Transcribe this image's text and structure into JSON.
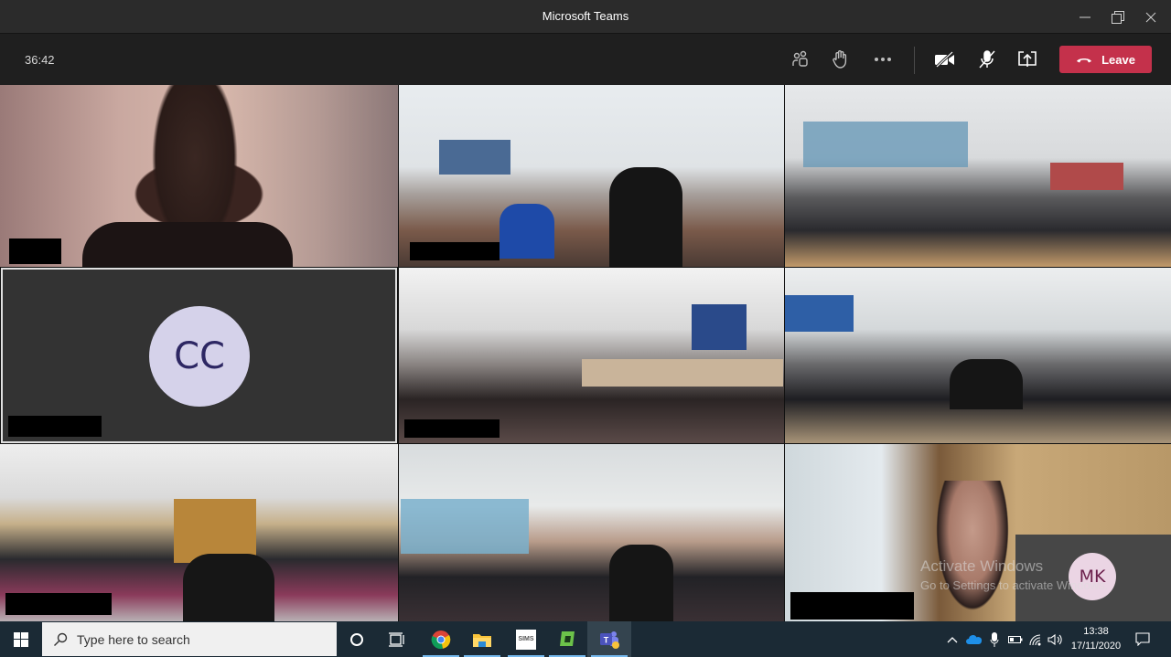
{
  "window": {
    "title": "Microsoft Teams",
    "controls": [
      "minimize-icon",
      "restore-icon",
      "close-icon"
    ]
  },
  "toolbar": {
    "timer": "36:42",
    "buttons": [
      {
        "name": "participants-button",
        "icon": "people-icon"
      },
      {
        "name": "raise-hand-button",
        "icon": "hand-icon"
      },
      {
        "name": "more-actions-button",
        "icon": "ellipsis-icon"
      },
      {
        "name": "camera-toggle-button",
        "icon": "camera-off-icon"
      },
      {
        "name": "mic-toggle-button",
        "icon": "mic-off-icon"
      },
      {
        "name": "share-screen-button",
        "icon": "share-tray-icon"
      }
    ],
    "leave_label": "Leave",
    "leave_color": "#c4314b"
  },
  "video_grid": {
    "tiles": [
      {
        "type": "video",
        "description": "Woman at home with blurred background",
        "name_redacted": true
      },
      {
        "type": "video",
        "description": "Classroom with student standing",
        "name_redacted": true
      },
      {
        "type": "video",
        "description": "Classroom with students at desks",
        "name_redacted": true
      },
      {
        "type": "avatar",
        "initials": "CC",
        "avatar_bg": "#d5d2ea",
        "avatar_fg": "#2d2763",
        "name_redacted": true,
        "selected": true
      },
      {
        "type": "video",
        "description": "Classroom students seated",
        "name_redacted": true
      },
      {
        "type": "video",
        "description": "Classroom students seated wide",
        "name_redacted": true
      },
      {
        "type": "video",
        "description": "Classroom students at front desks",
        "name_redacted": true
      },
      {
        "type": "video",
        "description": "Classroom with board and windows",
        "name_redacted": true
      },
      {
        "type": "video",
        "description": "Woman with hand on chin",
        "name_redacted": true
      }
    ],
    "self_preview": {
      "initials": "MK",
      "avatar_bg": "#ebd5e4",
      "avatar_fg": "#6b1f4b"
    }
  },
  "watermark": {
    "line1": "Activate Windows",
    "line2": "Go to Settings to activate Windows."
  },
  "taskbar": {
    "search_placeholder": "Type here to search",
    "apps": [
      {
        "name": "cortana",
        "icon": "circle-icon"
      },
      {
        "name": "task-view",
        "icon": "task-view-icon"
      },
      {
        "name": "chrome",
        "icon": "chrome-icon",
        "running": true
      },
      {
        "name": "file-explorer",
        "icon": "folder-icon",
        "running": true
      },
      {
        "name": "sims",
        "icon": "sims-icon",
        "label": "SIMS",
        "running": true
      },
      {
        "name": "green-app",
        "icon": "green-app-icon",
        "running": true
      },
      {
        "name": "teams",
        "icon": "teams-icon",
        "running": true,
        "active": true
      }
    ],
    "tray": [
      "chevron-up-icon",
      "onedrive-icon",
      "microphone-icon",
      "battery-icon",
      "wifi-icon",
      "volume-icon"
    ],
    "time": "13:38",
    "date": "17/11/2020"
  }
}
